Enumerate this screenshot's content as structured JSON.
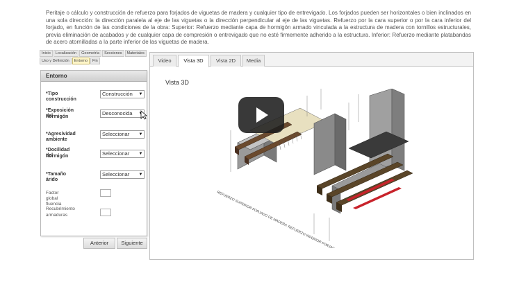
{
  "intro": "Peritaje o cálculo y construcción de refuerzo para forjados de viguetas de madera y cualquier tipo de entrevigado. Los forjados pueden ser horizontales o bien inclinados en una sola dirección: la dirección paralela al eje de las viguetas o la dirección perpendicular al eje de las viguetas. Refuerzo por la cara superior o por la cara inferior del forjado, en función de las condiciones de la obra: Superior: Refuerzo mediante capa de hormigón armado vinculada a la estructura de madera con tornillos estructurales, previa eliminación de acabados y de cualquier capa de compresión o entrevigado que no esté firmemente adherido a la estructura. Inferior: Refuerzo mediante platabandas de acero atornilladas a la parte inferior de las viguetas de madera.",
  "wizard_tabs": [
    "Inicio",
    "Localización",
    "Geometría",
    "Secciones",
    "Materiales",
    "Uso y Definición",
    "Entorno",
    "Fin"
  ],
  "active_wizard_tab": "Entorno",
  "form": {
    "title": "Entorno",
    "fields": [
      {
        "label_1": "*Tipo construcción",
        "label_2": "",
        "value": "Construcción"
      },
      {
        "label_1": "*Exposición del",
        "label_2": "hormigón",
        "value": "Desconocida"
      },
      {
        "label_1": "*Agresividad ambiente",
        "label_2": "",
        "value": "Seleccionar"
      },
      {
        "label_1": "*Docilidad del",
        "label_2": "hormigón",
        "value": "Seleccionar"
      },
      {
        "label_1": "*Tamaño árido",
        "label_2": "",
        "value": "Seleccionar"
      }
    ],
    "factor_label": "Factor global fluencia",
    "recubrimiento_label_1": "Recubrimiento",
    "recubrimiento_label_2": "armaduras"
  },
  "buttons": {
    "prev": "Anterior",
    "next": "Siguiente"
  },
  "view_tabs": [
    "Video",
    "Vista 3D",
    "Vista 2D",
    "Media"
  ],
  "active_view_tab": "Vista 3D",
  "view_title": "Vista 3D",
  "drawing_label_top": "REFUERZO SUPERIOR FORJADO DE MADERA",
  "drawing_label_bottom": "REFUERZO INFERIOR FORJADO DE MADERA",
  "colors": {
    "accent_tab": "#fff6c8",
    "beam": "#6b4a2e",
    "plate": "#c8232b"
  }
}
